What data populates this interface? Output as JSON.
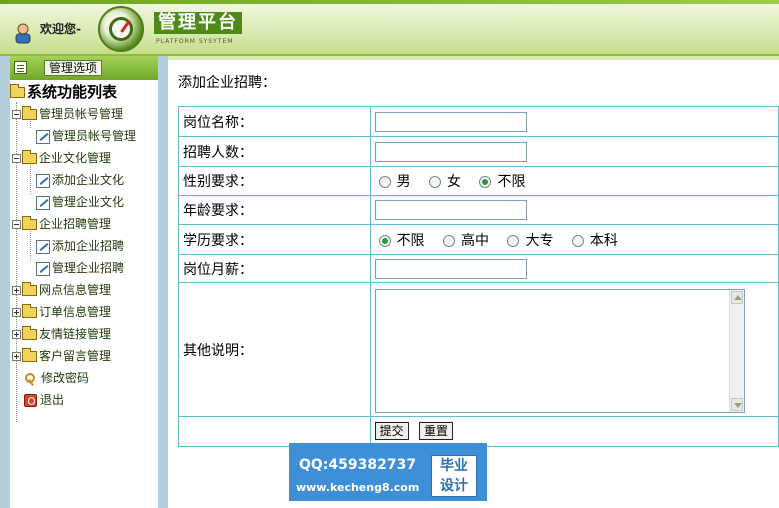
{
  "header": {
    "welcome": "欢迎您-",
    "logo_title": "管理平台",
    "logo_subtitle": "PLATFORM SYSYTEM"
  },
  "sidebar": {
    "head_button": "管理选项",
    "root": "系统功能列表",
    "items": [
      {
        "label": "管理员帐号管理",
        "type": "folder",
        "state": "open"
      },
      {
        "label": "管理员帐号管理",
        "type": "leaf"
      },
      {
        "label": "企业文化管理",
        "type": "folder",
        "state": "open"
      },
      {
        "label": "添加企业文化",
        "type": "leaf"
      },
      {
        "label": "管理企业文化",
        "type": "leaf"
      },
      {
        "label": "企业招聘管理",
        "type": "folder",
        "state": "open"
      },
      {
        "label": "添加企业招聘",
        "type": "leaf"
      },
      {
        "label": "管理企业招聘",
        "type": "leaf",
        "active": true
      },
      {
        "label": "网点信息管理",
        "type": "folder",
        "state": "closed"
      },
      {
        "label": "订单信息管理",
        "type": "folder",
        "state": "closed"
      },
      {
        "label": "友情链接管理",
        "type": "folder",
        "state": "closed"
      },
      {
        "label": "客户留言管理",
        "type": "folder",
        "state": "closed"
      },
      {
        "label": "修改密码",
        "type": "key"
      },
      {
        "label": "退出",
        "type": "exit"
      }
    ]
  },
  "main": {
    "title": "添加企业招聘：",
    "form": {
      "job_name_label": "岗位名称：",
      "job_name_value": "",
      "headcount_label": "招聘人数：",
      "headcount_value": "",
      "gender_label": "性别要求：",
      "gender_options": [
        "男",
        "女",
        "不限"
      ],
      "gender_selected": "不限",
      "age_label": "年龄要求：",
      "age_value": "",
      "education_label": "学历要求：",
      "education_options": [
        "不限",
        "高中",
        "大专",
        "本科"
      ],
      "education_selected": "不限",
      "salary_label": "岗位月薪：",
      "salary_value": "",
      "notes_label": "其他说明：",
      "notes_value": "",
      "submit_label": "提交",
      "reset_label": "重置"
    }
  },
  "watermark": {
    "qq": "QQ:459382737",
    "url": "www.kecheng8.com",
    "seal_line1": "毕业",
    "seal_line2": "设计"
  },
  "colors": {
    "accent_green": "#70a82a",
    "table_border": "#5ec0cf",
    "active_link": "#cc0000",
    "watermark_blue": "#3d8fd8"
  }
}
